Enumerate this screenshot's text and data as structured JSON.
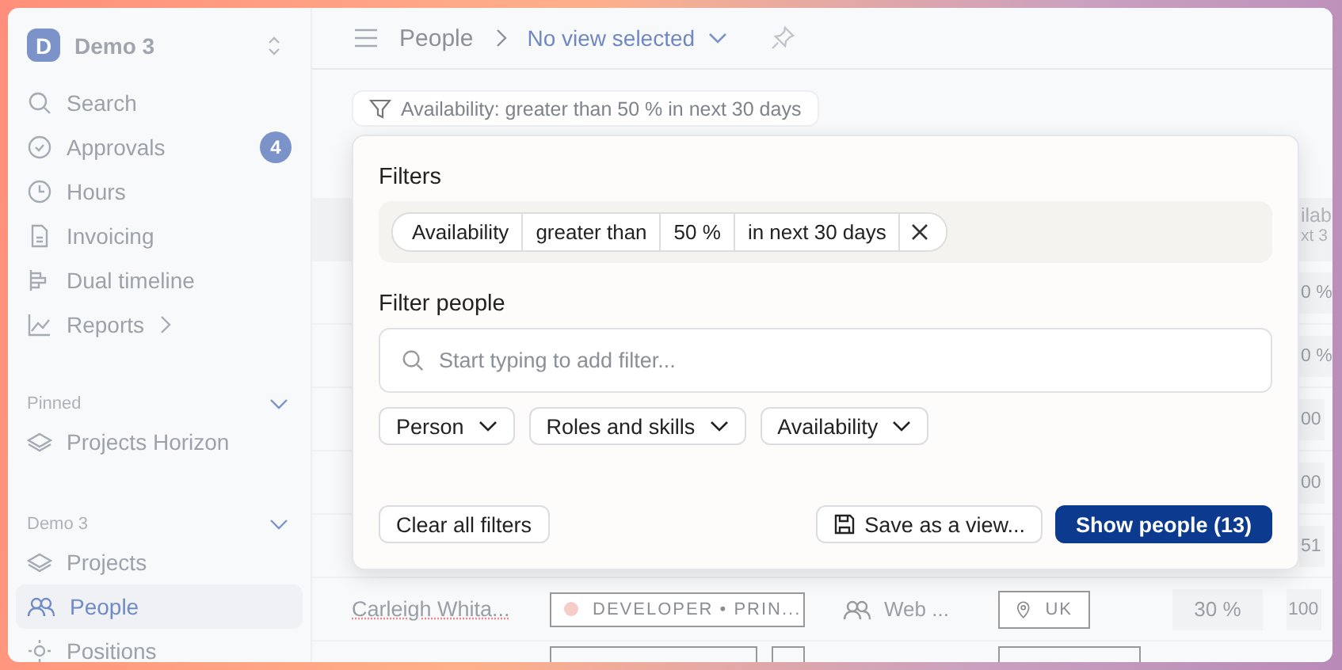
{
  "workspace": {
    "initial": "D",
    "name": "Demo 3"
  },
  "sidebar": {
    "nav": [
      {
        "label": "Search"
      },
      {
        "label": "Approvals",
        "badge": "4"
      },
      {
        "label": "Hours"
      },
      {
        "label": "Invoicing"
      },
      {
        "label": "Dual timeline"
      },
      {
        "label": "Reports",
        "submenu": true
      }
    ],
    "sections": [
      {
        "title": "Pinned",
        "expanded": true,
        "items": [
          {
            "label": "Projects Horizon",
            "selected": false
          }
        ]
      },
      {
        "title": "Demo 3",
        "expanded": true,
        "items": [
          {
            "label": "Projects",
            "selected": false
          },
          {
            "label": "People",
            "selected": true
          },
          {
            "label": "Positions",
            "selected": false
          }
        ]
      }
    ]
  },
  "header": {
    "breadcrumb": "People",
    "view": "No view selected"
  },
  "active_filter": "Availability: greater than 50 % in next 30 days",
  "table": {
    "column_header": [
      "ilab",
      "xt 3"
    ],
    "rows": [
      {
        "kind": "covered",
        "last": "0 %"
      },
      {
        "kind": "covered",
        "last": "0 %"
      },
      {
        "kind": "covered",
        "last": "00"
      },
      {
        "kind": "covered",
        "last": "00"
      },
      {
        "kind": "covered",
        "last": "51"
      },
      {
        "kind": "full",
        "name": "Carleigh Whita...",
        "role": "DEVELOPER • PRIN...",
        "color": "#f6cdc6",
        "team": "Web ...",
        "location": "UK",
        "availability": "30 %",
        "last": "100"
      },
      {
        "kind": "outline"
      }
    ]
  },
  "filter_popup": {
    "title": "Filters",
    "chips": [
      "Availability",
      "greater than",
      "50 %",
      "in next 30 days"
    ],
    "section_title": "Filter people",
    "search": {
      "placeholder": "Start typing to add filter..."
    },
    "dropdowns": [
      "Person",
      "Roles and skills",
      "Availability"
    ],
    "clear_button": "Clear all filters",
    "save_button": "Save as a view...",
    "show_button": "Show people (13)"
  }
}
